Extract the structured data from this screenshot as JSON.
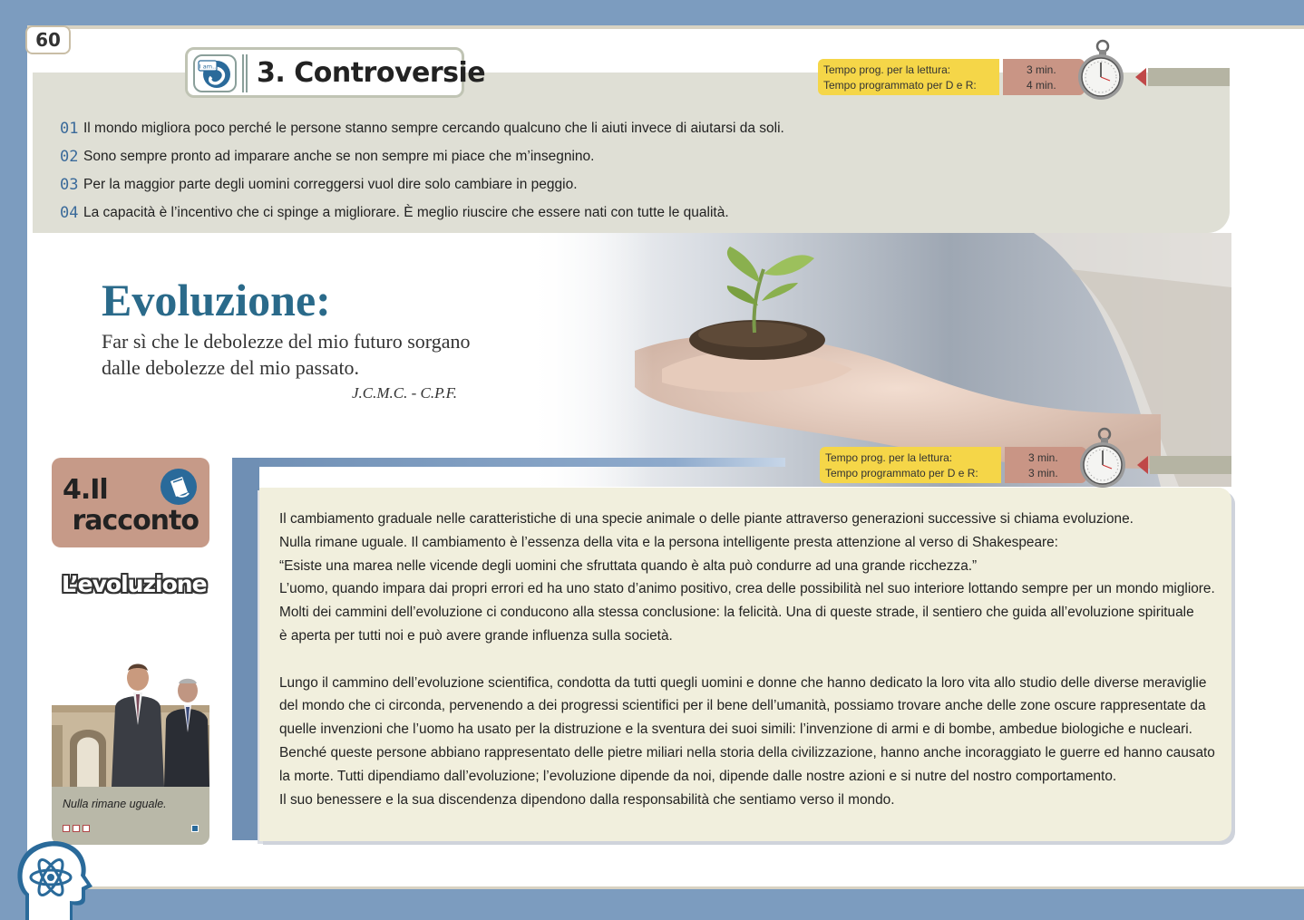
{
  "page_number": "60",
  "section3": {
    "title": "3. Controversie",
    "icon_label": "I am..",
    "timer": {
      "label_read": "Tempo prog. per la lettura:",
      "label_qa": "Tempo programmato per D e R:",
      "value_read": "3 min.",
      "value_qa": "4 min."
    },
    "items": [
      {
        "num": "01",
        "text": "Il mondo migliora poco perché le persone stanno sempre cercando qualcuno che li aiuti invece di aiutarsi da soli."
      },
      {
        "num": "02",
        "text": "Sono sempre pronto ad imparare anche se non sempre mi piace che m’insegnino."
      },
      {
        "num": "03",
        "text": "Per la maggior parte degli uomini correggersi vuol dire solo cambiare in peggio."
      },
      {
        "num": "04",
        "text": "La capacità è l’incentivo che ci spinge a migliorare. È meglio riuscire che essere nati con tutte le qualità."
      }
    ]
  },
  "evolution": {
    "title": "Evoluzione:",
    "quote_line1": "Far sì che le debolezze del mio futuro sorgano",
    "quote_line2": "dalle debolezze del mio passato.",
    "author": "J.C.M.C. - C.P.F."
  },
  "section4": {
    "title_line1": "4.Il",
    "title_line2": "racconto",
    "subtitle": "L’evoluzione",
    "caption": "Nulla rimane uguale.",
    "timer": {
      "label_read": "Tempo prog. per la lettura:",
      "label_qa": "Tempo programmato per D e R:",
      "value_read": "3 min.",
      "value_qa": "3 min."
    },
    "paragraph1": [
      "Il cambiamento graduale nelle caratteristiche di una specie animale o delle piante attraverso generazioni successive si chiama evoluzione.",
      "Nulla rimane uguale. Il  cambiamento è l’essenza della vita e la persona intelligente presta attenzione al verso di Shakespeare:",
      "“Esiste una marea nelle vicende degli uomini che sfruttata quando è alta può condurre ad una grande ricchezza.”",
      "L’uomo, quando impara dai propri errori ed ha uno stato d’animo positivo, crea delle possibilità nel suo interiore lottando sempre per un mondo migliore.",
      "Molti dei cammini dell’evoluzione ci conducono alla stessa conclusione: la felicità. Una di queste strade, il sentiero che guida all’evoluzione spirituale",
      "è aperta per tutti noi e può avere grande influenza sulla società."
    ],
    "paragraph2": [
      "Lungo il cammino dell’evoluzione scientifica, condotta da tutti quegli uomini e donne che hanno dedicato la loro vita allo studio delle diverse meraviglie",
      "del mondo che ci circonda, pervenendo a dei progressi scientifici per il bene dell’umanità, possiamo trovare anche delle zone oscure rappresentate da",
      "quelle invenzioni che l’uomo ha usato per la distruzione e la sventura dei suoi simili: l’invenzione di armi e di bombe, ambedue biologiche e nucleari.",
      "Benché queste persone abbiano rappresentato delle pietre miliari nella storia della civilizzazione, hanno anche incoraggiato le guerre ed hanno causato",
      "la morte. Tutti dipendiamo dall’evoluzione; l’evoluzione dipende da noi, dipende dalle nostre azioni e si nutre del nostro comportamento.",
      "Il suo benessere e la sua discendenza dipendono dalla responsabilità che sentiamo verso il mondo."
    ]
  },
  "colors": {
    "frame_blue": "#7c9cbf",
    "panel_grey": "#dfdfd5",
    "timer_yellow": "#f5d648",
    "timer_rose": "#c99585",
    "title_teal": "#2a6a8a",
    "story_bg": "#f1efdd"
  },
  "icons": [
    "i-am-icon",
    "stopwatch-icon",
    "book-icon",
    "atom-head-icon"
  ]
}
